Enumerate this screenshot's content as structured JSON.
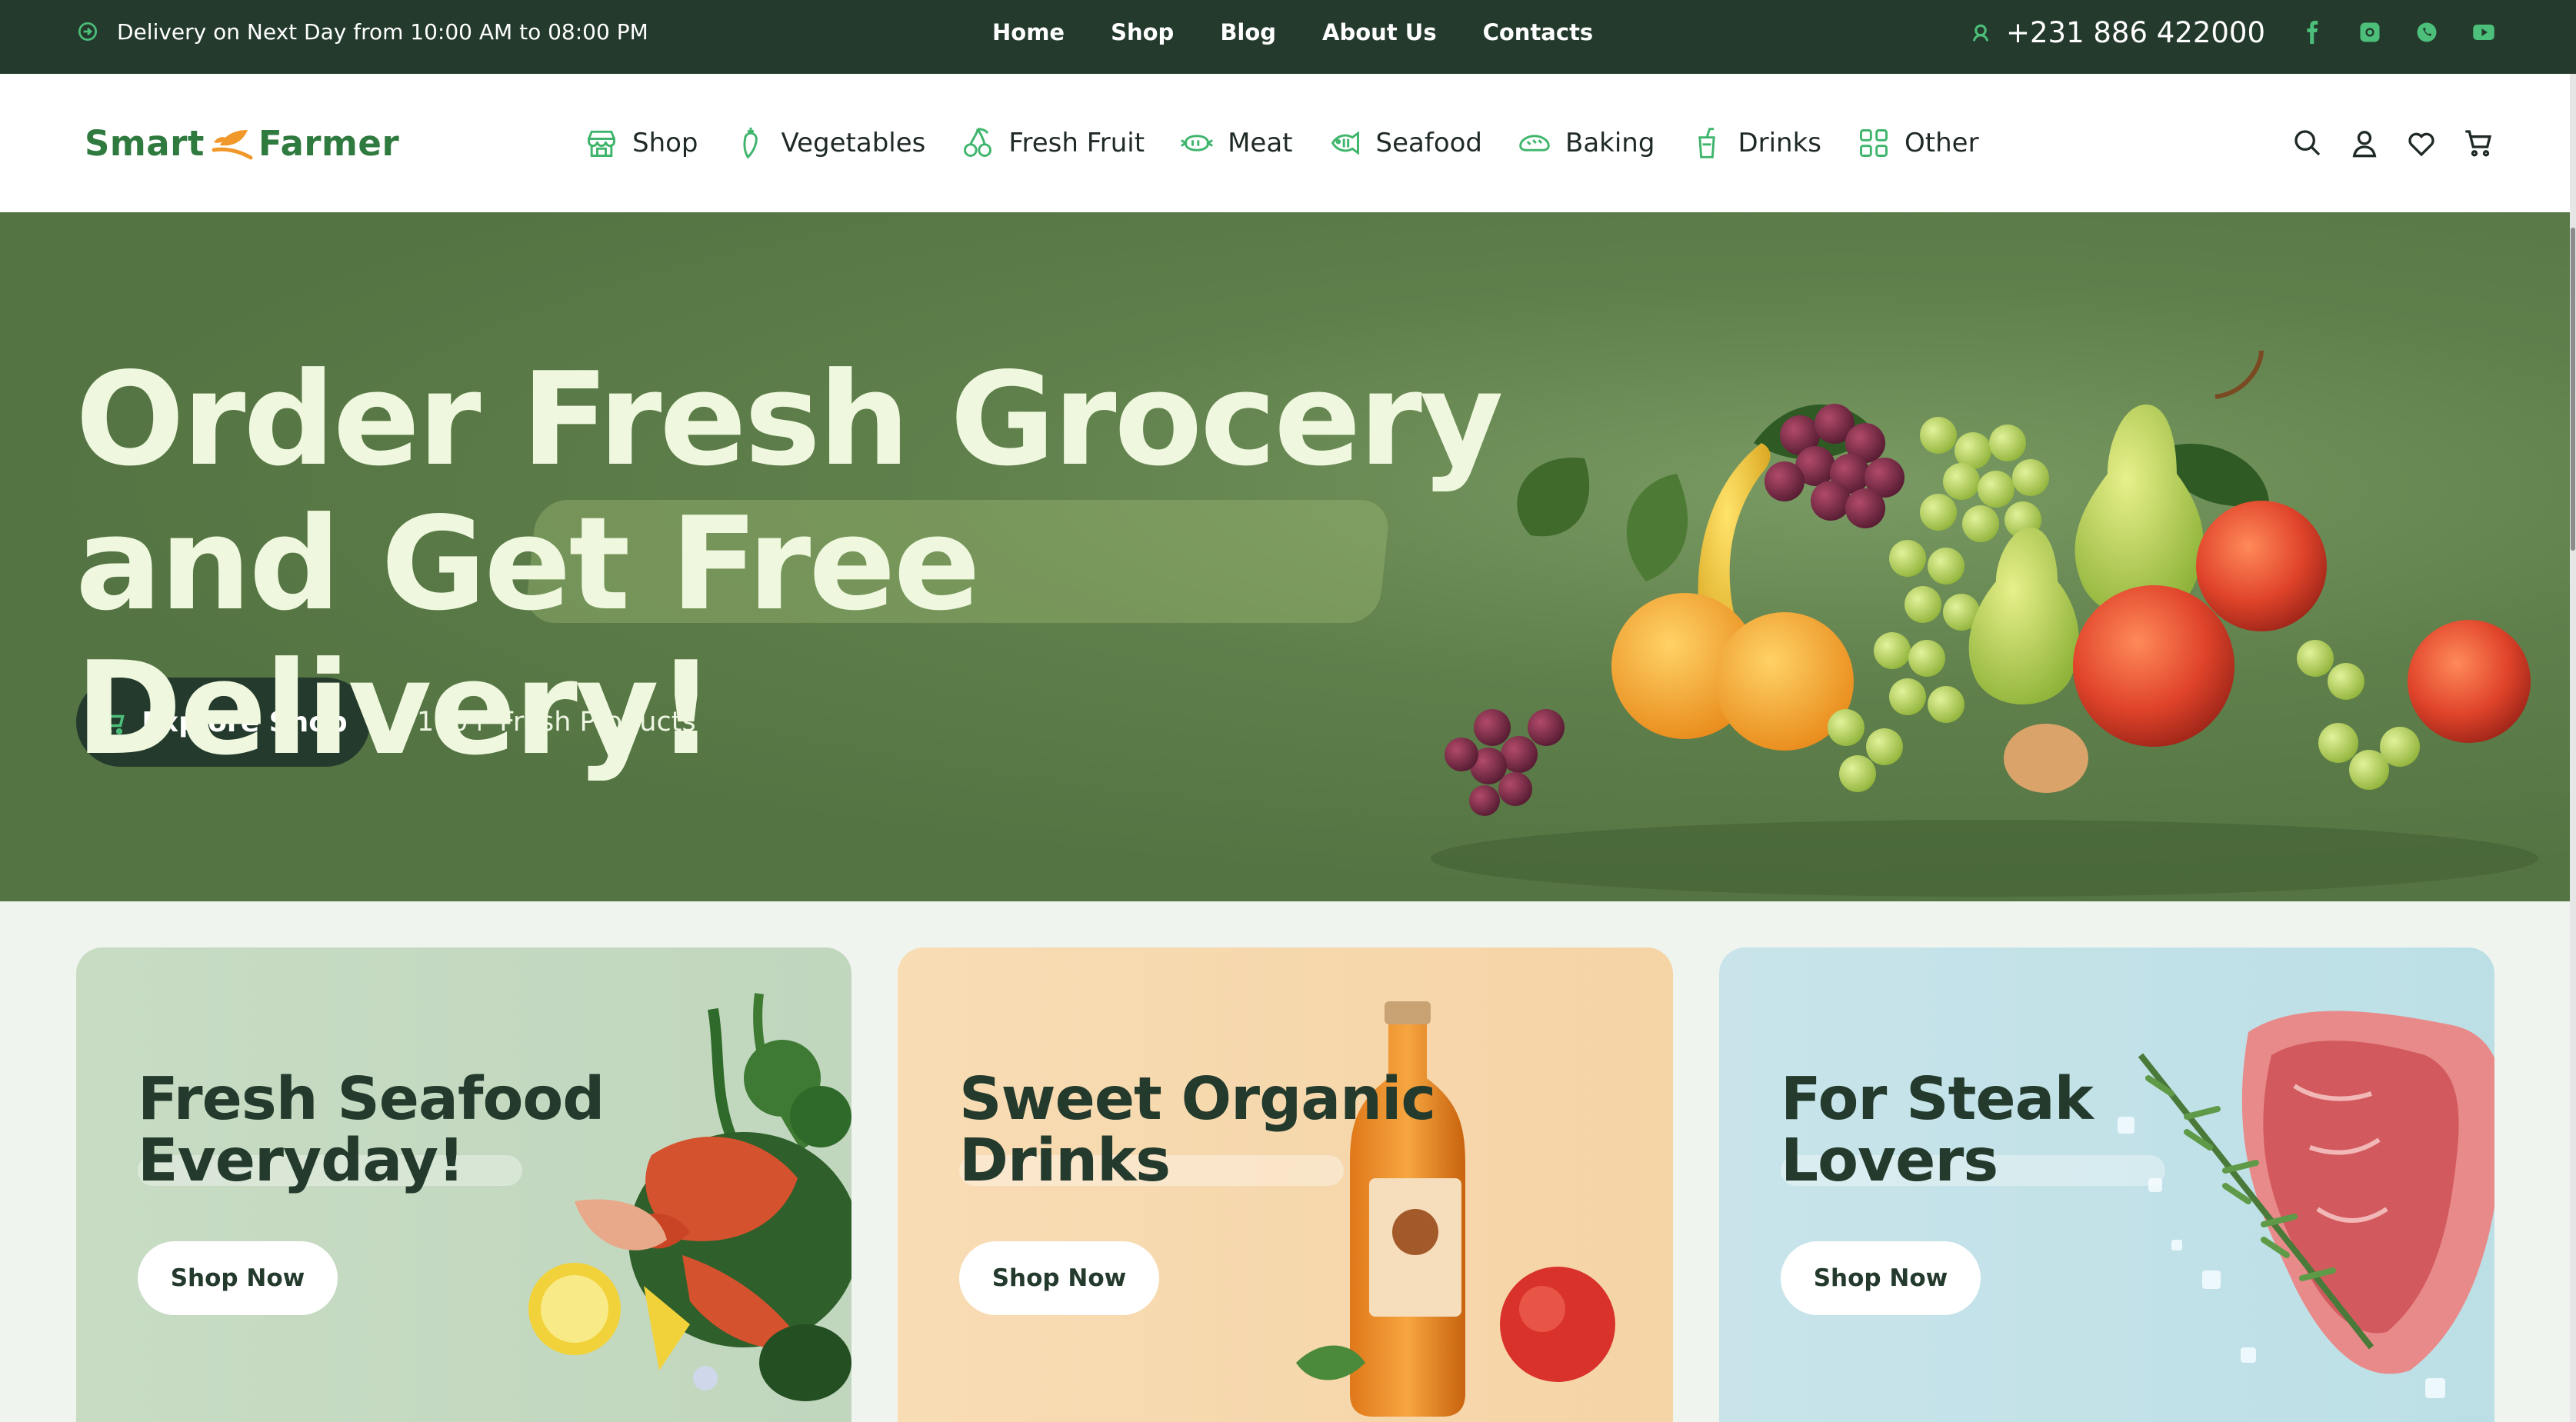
{
  "topbar": {
    "delivery_text": "Delivery on Next Day from 10:00 AM to 08:00 PM",
    "nav": [
      "Home",
      "Shop",
      "Blog",
      "About Us",
      "Contacts"
    ],
    "phone": "+231 886 422000",
    "socials": [
      "facebook-icon",
      "instagram-icon",
      "whatsapp-icon",
      "youtube-icon"
    ]
  },
  "header": {
    "logo_left": "Smart",
    "logo_right": "Farmer",
    "categories": [
      {
        "label": "Shop",
        "icon": "store-icon"
      },
      {
        "label": "Vegetables",
        "icon": "carrot-icon"
      },
      {
        "label": "Fresh Fruit",
        "icon": "cherry-icon"
      },
      {
        "label": "Meat",
        "icon": "sausage-icon"
      },
      {
        "label": "Seafood",
        "icon": "fish-icon"
      },
      {
        "label": "Baking",
        "icon": "bread-icon"
      },
      {
        "label": "Drinks",
        "icon": "drink-icon"
      },
      {
        "label": "Other",
        "icon": "grid-icon"
      }
    ],
    "actions": [
      "search-icon",
      "user-icon",
      "heart-icon",
      "cart-icon"
    ]
  },
  "hero": {
    "title_line1": "Order Fresh Grocery",
    "title_line2": "and Get Free Delivery!",
    "cta_label": "Explore Shop",
    "product_count": "100+ Fresh Products"
  },
  "promos": [
    {
      "title_line1": "Fresh Seafood",
      "title_line2": "Everyday!",
      "button": "Shop Now"
    },
    {
      "title_line1": "Sweet Organic",
      "title_line2": "Drinks",
      "button": "Shop Now"
    },
    {
      "title_line1": "For Steak",
      "title_line2": "Lovers",
      "button": "Shop Now"
    }
  ],
  "colors": {
    "accent_green": "#2f7a3e",
    "dark_green": "#243a2d",
    "hero_green": "#5f7f4b",
    "logo_orange": "#f0982a"
  }
}
